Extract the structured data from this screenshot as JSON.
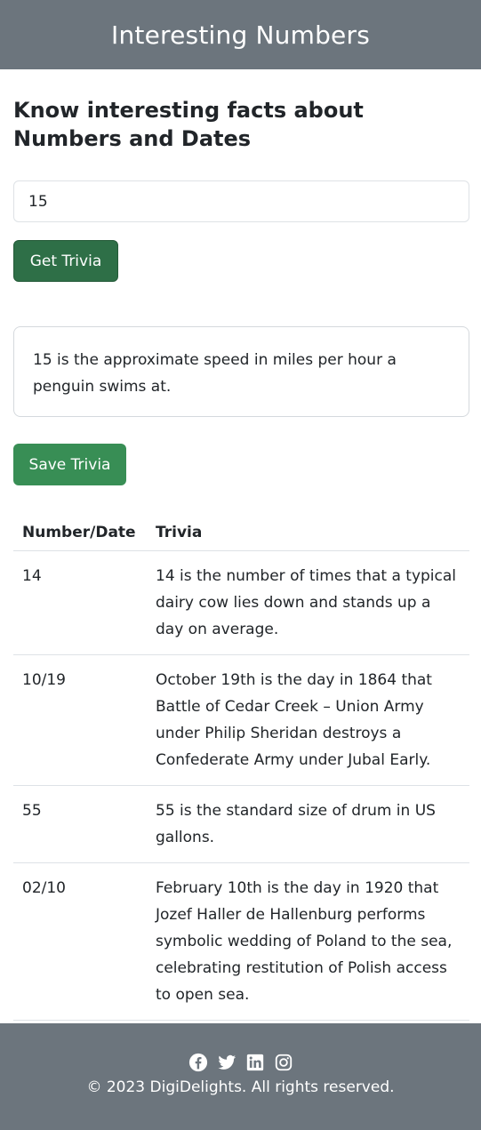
{
  "header": {
    "title": "Interesting Numbers"
  },
  "main": {
    "heading": "Know interesting facts about Numbers and Dates",
    "input": {
      "value": "15",
      "placeholder": ""
    },
    "get_button": "Get Trivia",
    "result_text": "15 is the approximate speed in miles per hour a penguin swims at.",
    "save_button": "Save Trivia"
  },
  "table": {
    "headers": [
      "Number/Date",
      "Trivia"
    ],
    "rows": [
      {
        "key": "14",
        "trivia": "14 is the number of times that a typical dairy cow lies down and stands up a day on average."
      },
      {
        "key": "10/19",
        "trivia": "October 19th is the day in 1864 that Battle of Cedar Creek – Union Army under Philip Sheridan destroys a Confederate Army under Jubal Early."
      },
      {
        "key": "55",
        "trivia": "55 is the standard size of drum in US gallons."
      },
      {
        "key": "02/10",
        "trivia": "February 10th is the day in 1920 that Jozef Haller de Hallenburg performs symbolic wedding of Poland to the sea, celebrating restitution of Polish access to open sea."
      }
    ]
  },
  "footer": {
    "icons": [
      "facebook-icon",
      "twitter-icon",
      "linkedin-icon",
      "instagram-icon"
    ],
    "copyright": "© 2023 DigiDelights. All rights reserved."
  },
  "colors": {
    "header_bg": "#6c757d",
    "get_button": "#2e6f47",
    "save_button": "#388e55",
    "footer_bg": "#6c757d"
  }
}
